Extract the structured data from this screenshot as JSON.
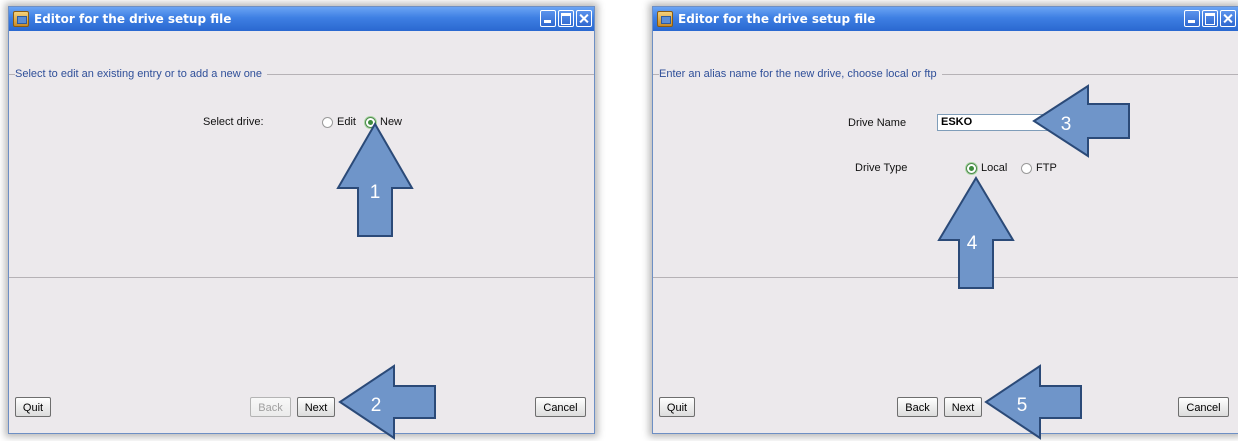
{
  "windows": [
    {
      "title": "Editor for the drive setup file",
      "section_title": "Select to edit an existing entry or to add a new one",
      "select_drive_label": "Select drive:",
      "radio_edit_label": "Edit",
      "radio_new_label": "New",
      "selected": "New",
      "buttons": {
        "quit": "Quit",
        "back": "Back",
        "back_enabled": false,
        "next": "Next",
        "cancel": "Cancel"
      },
      "arrows": [
        "1",
        "2"
      ]
    },
    {
      "title": "Editor for the drive setup file",
      "section_title": "Enter an alias name for the new drive, choose local or ftp",
      "drive_name_label": "Drive Name",
      "drive_name_value": "ESKO",
      "drive_type_label": "Drive Type",
      "radio_local_label": "Local",
      "radio_ftp_label": "FTP",
      "selected": "Local",
      "buttons": {
        "quit": "Quit",
        "back": "Back",
        "back_enabled": true,
        "next": "Next",
        "cancel": "Cancel"
      },
      "arrows": [
        "3",
        "4",
        "5"
      ]
    }
  ],
  "colors": {
    "arrow_fill": "#6f95c9",
    "arrow_stroke": "#2b4a78",
    "titlebar": "#3e7fe3",
    "section_title": "#2f4f99"
  }
}
